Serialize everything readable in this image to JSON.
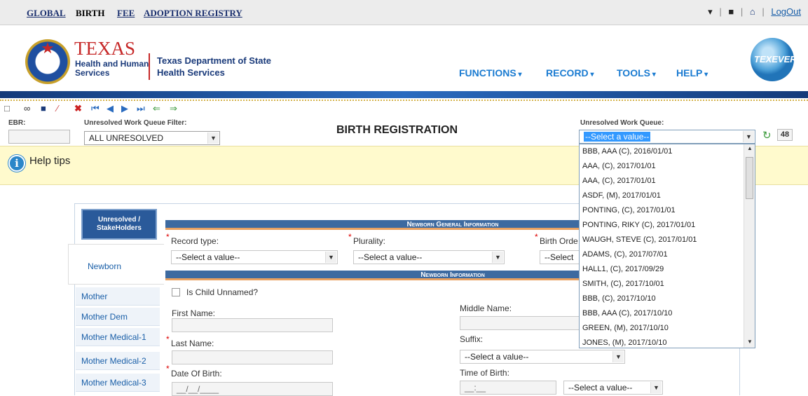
{
  "topnav": {
    "global": "GLOBAL",
    "birth": "BIRTH",
    "fee": "FEE",
    "adoption": "ADOPTION REGISTRY",
    "logout": "LogOut",
    "sep": "|"
  },
  "header": {
    "texas": "TEXAS",
    "hhs_line1": "Health and Human",
    "hhs_line2": "Services",
    "dept_line1": "Texas Department of State",
    "dept_line2": "Health Services",
    "globe_text": "TEXEVER",
    "nav": [
      "FUNCTIONS",
      "RECORD",
      "TOOLS",
      "HELP"
    ]
  },
  "toolbar": {
    "ebr_label": "EBR:",
    "filter_label": "Unresolved Work Queue Filter:",
    "filter_value": "ALL UNRESOLVED",
    "queue_label": "Unresolved Work Queue:",
    "queue_value": "--Select a value--",
    "queue_count": "48"
  },
  "page_title": "BIRTH REGISTRATION",
  "help": {
    "text": "Help tips"
  },
  "sidebar": {
    "header": "Unresolved / StakeHolders",
    "active": "Newborn",
    "items": [
      "Mother",
      "Mother Dem",
      "Mother Medical-1",
      "Mother Medical-2",
      "Mother Medical-3"
    ]
  },
  "sections": {
    "general": "Newborn General Information",
    "newborn": "Newborn Information"
  },
  "form": {
    "record_type": "Record type:",
    "plurality": "Plurality:",
    "birth_order": "Birth Orde",
    "select_value": "--Select a value--",
    "select_partial": "--Select a",
    "unnamed": "Is Child Unnamed?",
    "first_name": "First Name:",
    "middle_name": "Middle Name:",
    "last_name": "Last Name:",
    "suffix": "Suffix:",
    "dob": "Date Of Birth:",
    "dob_placeholder": "__/__/____",
    "tob": "Time of Birth:",
    "tob_placeholder": "__:__"
  },
  "queue_items": [
    "BBB, AAA (C), 2016/01/01",
    "AAA, (C), 2017/01/01",
    "AAA, (C), 2017/01/01",
    "ASDF, (M), 2017/01/01",
    "PONTING, (C), 2017/01/01",
    "PONTING, RIKY (C), 2017/01/01",
    "WAUGH, STEVE (C), 2017/01/01",
    "ADAMS, (C), 2017/07/01",
    "HALL1, (C), 2017/09/29",
    "SMITH, (C), 2017/10/01",
    "BBB, (C), 2017/10/10",
    "BBB, AAA (C), 2017/10/10",
    "GREEN, (M), 2017/10/10",
    "JONES, (M), 2017/10/10"
  ],
  "colors": {
    "nav": "#1a7bd1",
    "brand_red": "#c62828",
    "brand_blue": "#1a3a7a",
    "section_bar": "#3d6aa0",
    "help_bg": "#fffacd"
  }
}
